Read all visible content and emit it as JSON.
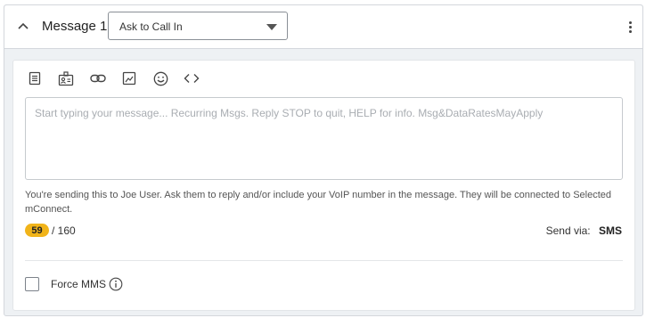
{
  "header": {
    "title": "Message 1",
    "dropdown": {
      "selected": "Ask to Call In"
    }
  },
  "toolbar": {
    "tools": [
      {
        "icon": "document-icon"
      },
      {
        "icon": "contact-card-icon"
      },
      {
        "icon": "link-icon"
      },
      {
        "icon": "image-icon"
      },
      {
        "icon": "emoji-icon"
      },
      {
        "icon": "code-icon"
      }
    ]
  },
  "editor": {
    "placeholder": "Start typing your message... Recurring Msgs. Reply STOP to quit, HELP for info. Msg&DataRatesMayApply"
  },
  "info_text": "You're sending this to Joe User. Ask them to reply and/or include your VoIP number in the message. They will be connected to Selected mConnect.",
  "counter": {
    "count": "59",
    "limit": "/ 160"
  },
  "send_via": {
    "label": "Send via:",
    "method": "SMS"
  },
  "force_mms": {
    "label": "Force MMS",
    "checked": false
  },
  "colors": {
    "badge": "#f1b41a",
    "panel_bg": "#eef1f4",
    "border": "#d4d7dc"
  }
}
